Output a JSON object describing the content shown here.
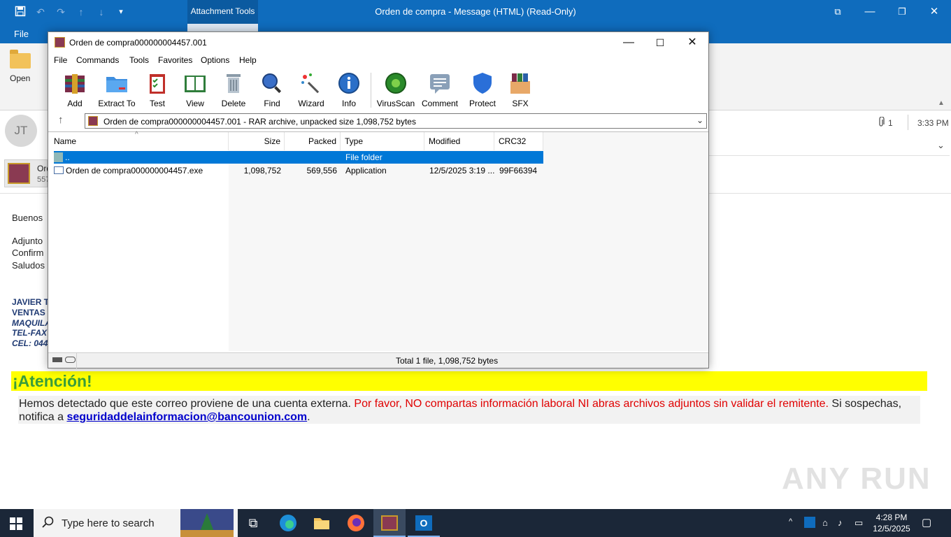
{
  "outlook": {
    "context_tab": "Attachment Tools",
    "caption": "Orden de compra  -  Message (HTML) (Read-Only)",
    "tabs": [
      "File"
    ],
    "ribbon": {
      "open_label": "Open"
    },
    "sender_initials": "JT",
    "attachment_count": "1",
    "time": "3:33 PM",
    "attachment_chip": {
      "name": "Ord",
      "size": "557"
    },
    "body": {
      "greeting": "Buenos",
      "line1": "Adjunto",
      "line2": "Confirm",
      "line3": "Saludos",
      "sig1": "JAVIER T",
      "sig2": "VENTAS",
      "sig3": "MAQUILA",
      "sig4": "TEL-FAX",
      "sig5": "CEL: 044"
    },
    "warning": {
      "title": "¡Atención!",
      "text1": "Hemos detectado que este correo proviene de una cuenta externa. ",
      "text_red": "Por favor, NO compartas información laboral NI abras archivos adjuntos sin validar el remitente.",
      "text2": " Si sospechas, notifica a ",
      "email": "seguridaddelainformacion@bancounion.com",
      "text3": "."
    }
  },
  "winrar": {
    "title": "Orden de compra000000004457.001",
    "menu": [
      "File",
      "Commands",
      "Tools",
      "Favorites",
      "Options",
      "Help"
    ],
    "tools": [
      {
        "label": "Add",
        "icon": "add-archive-icon"
      },
      {
        "label": "Extract To",
        "icon": "extract-folder-icon"
      },
      {
        "label": "Test",
        "icon": "test-clipboard-icon"
      },
      {
        "label": "View",
        "icon": "view-book-icon"
      },
      {
        "label": "Delete",
        "icon": "delete-bin-icon"
      },
      {
        "label": "Find",
        "icon": "find-magnifier-icon"
      },
      {
        "label": "Wizard",
        "icon": "wizard-wand-icon"
      },
      {
        "label": "Info",
        "icon": "info-icon"
      },
      {
        "label": "VirusScan",
        "icon": "virus-scan-icon"
      },
      {
        "label": "Comment",
        "icon": "comment-icon"
      },
      {
        "label": "Protect",
        "icon": "protect-shield-icon"
      },
      {
        "label": "SFX",
        "icon": "sfx-box-icon"
      }
    ],
    "address": "Orden de compra000000004457.001 - RAR archive, unpacked size 1,098,752 bytes",
    "columns": [
      "Name",
      "Size",
      "Packed",
      "Type",
      "Modified",
      "CRC32"
    ],
    "rows": [
      {
        "name": "..",
        "size": "",
        "packed": "",
        "type": "File folder",
        "modified": "",
        "crc": ""
      },
      {
        "name": "Orden de compra000000004457.exe",
        "size": "1,098,752",
        "packed": "569,556",
        "type": "Application",
        "modified": "12/5/2025 3:19 ...",
        "crc": "99F66394"
      }
    ],
    "status": "Total 1 file, 1,098,752 bytes"
  },
  "taskbar": {
    "search_placeholder": "Type here to search",
    "time": "4:28 PM",
    "date": "12/5/2025"
  },
  "watermark": "ANY RUN"
}
